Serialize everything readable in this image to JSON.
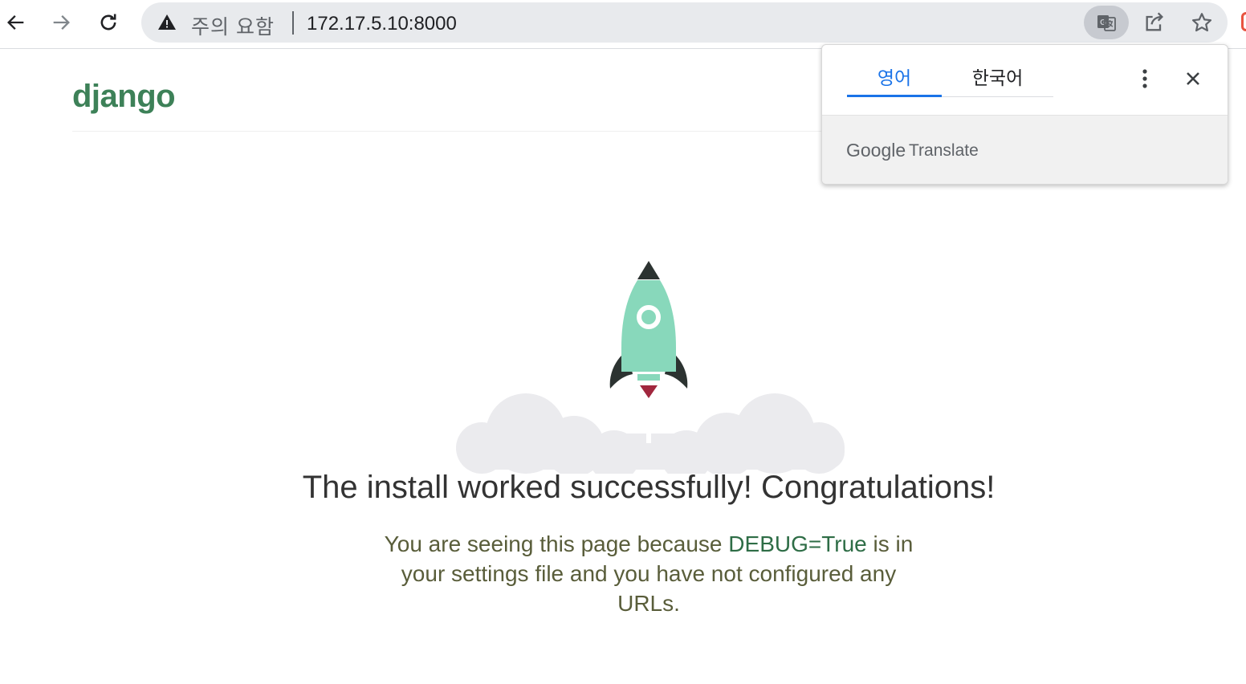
{
  "browser": {
    "security_label": "주의 요함",
    "url": "172.17.5.10:8000",
    "icons": {
      "back": "arrow-left-icon",
      "forward": "arrow-right-icon",
      "reload": "reload-icon",
      "warning": "warning-triangle-icon",
      "translate": "translate-icon",
      "share": "share-icon",
      "bookmark": "star-icon"
    }
  },
  "page": {
    "logo": "django",
    "headline": "The install worked successfully! Congratulations!",
    "message_before": "You are seeing this page because ",
    "message_highlight": "DEBUG=True",
    "message_after": " is in your settings file and you have not configured any URLs."
  },
  "translate_popup": {
    "tab_source": "영어",
    "tab_target": "한국어",
    "brand_google": "Google",
    "brand_translate": "Translate",
    "active_tab": "source"
  },
  "colors": {
    "django_green": "#3d8158",
    "rocket_mint": "#88d8bb",
    "rocket_dark": "#2c3331",
    "rocket_flame": "#a1273e",
    "cloud": "#ebebee",
    "tab_active": "#1a73e8"
  }
}
